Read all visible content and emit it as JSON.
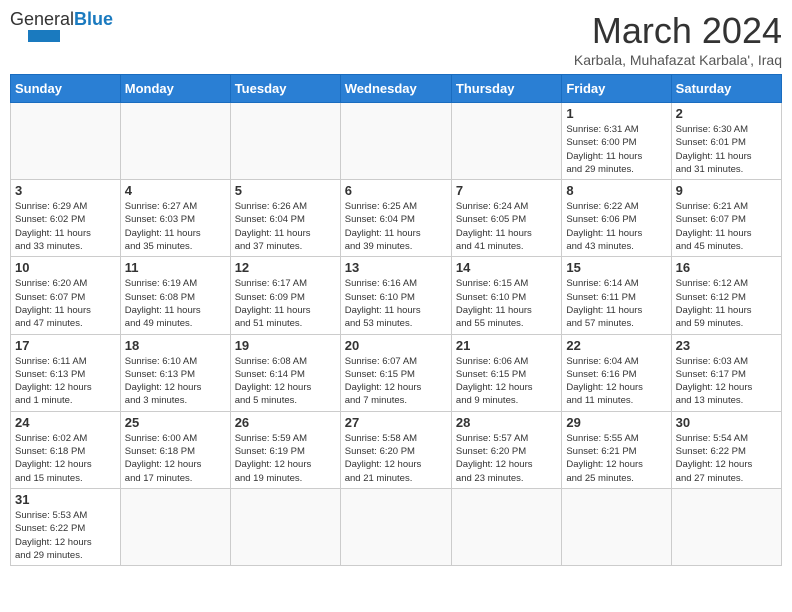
{
  "header": {
    "logo_general": "General",
    "logo_blue": "Blue",
    "title": "March 2024",
    "subtitle": "Karbala, Muhafazat Karbala', Iraq"
  },
  "weekdays": [
    "Sunday",
    "Monday",
    "Tuesday",
    "Wednesday",
    "Thursday",
    "Friday",
    "Saturday"
  ],
  "weeks": [
    [
      {
        "day": "",
        "info": ""
      },
      {
        "day": "",
        "info": ""
      },
      {
        "day": "",
        "info": ""
      },
      {
        "day": "",
        "info": ""
      },
      {
        "day": "",
        "info": ""
      },
      {
        "day": "1",
        "info": "Sunrise: 6:31 AM\nSunset: 6:00 PM\nDaylight: 11 hours\nand 29 minutes."
      },
      {
        "day": "2",
        "info": "Sunrise: 6:30 AM\nSunset: 6:01 PM\nDaylight: 11 hours\nand 31 minutes."
      }
    ],
    [
      {
        "day": "3",
        "info": "Sunrise: 6:29 AM\nSunset: 6:02 PM\nDaylight: 11 hours\nand 33 minutes."
      },
      {
        "day": "4",
        "info": "Sunrise: 6:27 AM\nSunset: 6:03 PM\nDaylight: 11 hours\nand 35 minutes."
      },
      {
        "day": "5",
        "info": "Sunrise: 6:26 AM\nSunset: 6:04 PM\nDaylight: 11 hours\nand 37 minutes."
      },
      {
        "day": "6",
        "info": "Sunrise: 6:25 AM\nSunset: 6:04 PM\nDaylight: 11 hours\nand 39 minutes."
      },
      {
        "day": "7",
        "info": "Sunrise: 6:24 AM\nSunset: 6:05 PM\nDaylight: 11 hours\nand 41 minutes."
      },
      {
        "day": "8",
        "info": "Sunrise: 6:22 AM\nSunset: 6:06 PM\nDaylight: 11 hours\nand 43 minutes."
      },
      {
        "day": "9",
        "info": "Sunrise: 6:21 AM\nSunset: 6:07 PM\nDaylight: 11 hours\nand 45 minutes."
      }
    ],
    [
      {
        "day": "10",
        "info": "Sunrise: 6:20 AM\nSunset: 6:07 PM\nDaylight: 11 hours\nand 47 minutes."
      },
      {
        "day": "11",
        "info": "Sunrise: 6:19 AM\nSunset: 6:08 PM\nDaylight: 11 hours\nand 49 minutes."
      },
      {
        "day": "12",
        "info": "Sunrise: 6:17 AM\nSunset: 6:09 PM\nDaylight: 11 hours\nand 51 minutes."
      },
      {
        "day": "13",
        "info": "Sunrise: 6:16 AM\nSunset: 6:10 PM\nDaylight: 11 hours\nand 53 minutes."
      },
      {
        "day": "14",
        "info": "Sunrise: 6:15 AM\nSunset: 6:10 PM\nDaylight: 11 hours\nand 55 minutes."
      },
      {
        "day": "15",
        "info": "Sunrise: 6:14 AM\nSunset: 6:11 PM\nDaylight: 11 hours\nand 57 minutes."
      },
      {
        "day": "16",
        "info": "Sunrise: 6:12 AM\nSunset: 6:12 PM\nDaylight: 11 hours\nand 59 minutes."
      }
    ],
    [
      {
        "day": "17",
        "info": "Sunrise: 6:11 AM\nSunset: 6:13 PM\nDaylight: 12 hours\nand 1 minute."
      },
      {
        "day": "18",
        "info": "Sunrise: 6:10 AM\nSunset: 6:13 PM\nDaylight: 12 hours\nand 3 minutes."
      },
      {
        "day": "19",
        "info": "Sunrise: 6:08 AM\nSunset: 6:14 PM\nDaylight: 12 hours\nand 5 minutes."
      },
      {
        "day": "20",
        "info": "Sunrise: 6:07 AM\nSunset: 6:15 PM\nDaylight: 12 hours\nand 7 minutes."
      },
      {
        "day": "21",
        "info": "Sunrise: 6:06 AM\nSunset: 6:15 PM\nDaylight: 12 hours\nand 9 minutes."
      },
      {
        "day": "22",
        "info": "Sunrise: 6:04 AM\nSunset: 6:16 PM\nDaylight: 12 hours\nand 11 minutes."
      },
      {
        "day": "23",
        "info": "Sunrise: 6:03 AM\nSunset: 6:17 PM\nDaylight: 12 hours\nand 13 minutes."
      }
    ],
    [
      {
        "day": "24",
        "info": "Sunrise: 6:02 AM\nSunset: 6:18 PM\nDaylight: 12 hours\nand 15 minutes."
      },
      {
        "day": "25",
        "info": "Sunrise: 6:00 AM\nSunset: 6:18 PM\nDaylight: 12 hours\nand 17 minutes."
      },
      {
        "day": "26",
        "info": "Sunrise: 5:59 AM\nSunset: 6:19 PM\nDaylight: 12 hours\nand 19 minutes."
      },
      {
        "day": "27",
        "info": "Sunrise: 5:58 AM\nSunset: 6:20 PM\nDaylight: 12 hours\nand 21 minutes."
      },
      {
        "day": "28",
        "info": "Sunrise: 5:57 AM\nSunset: 6:20 PM\nDaylight: 12 hours\nand 23 minutes."
      },
      {
        "day": "29",
        "info": "Sunrise: 5:55 AM\nSunset: 6:21 PM\nDaylight: 12 hours\nand 25 minutes."
      },
      {
        "day": "30",
        "info": "Sunrise: 5:54 AM\nSunset: 6:22 PM\nDaylight: 12 hours\nand 27 minutes."
      }
    ],
    [
      {
        "day": "31",
        "info": "Sunrise: 5:53 AM\nSunset: 6:22 PM\nDaylight: 12 hours\nand 29 minutes."
      },
      {
        "day": "",
        "info": ""
      },
      {
        "day": "",
        "info": ""
      },
      {
        "day": "",
        "info": ""
      },
      {
        "day": "",
        "info": ""
      },
      {
        "day": "",
        "info": ""
      },
      {
        "day": "",
        "info": ""
      }
    ]
  ]
}
